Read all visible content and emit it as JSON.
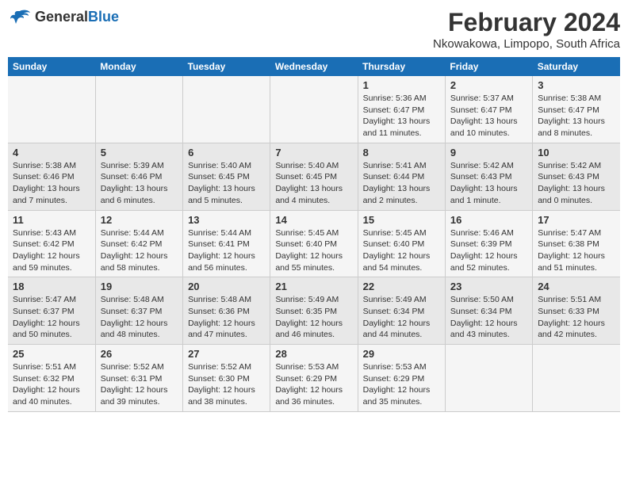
{
  "logo": {
    "text_general": "General",
    "text_blue": "Blue"
  },
  "title": "February 2024",
  "subtitle": "Nkowakowa, Limpopo, South Africa",
  "days_header": [
    "Sunday",
    "Monday",
    "Tuesday",
    "Wednesday",
    "Thursday",
    "Friday",
    "Saturday"
  ],
  "weeks": [
    [
      {
        "day": "",
        "content": ""
      },
      {
        "day": "",
        "content": ""
      },
      {
        "day": "",
        "content": ""
      },
      {
        "day": "",
        "content": ""
      },
      {
        "day": "1",
        "content": "Sunrise: 5:36 AM\nSunset: 6:47 PM\nDaylight: 13 hours\nand 11 minutes."
      },
      {
        "day": "2",
        "content": "Sunrise: 5:37 AM\nSunset: 6:47 PM\nDaylight: 13 hours\nand 10 minutes."
      },
      {
        "day": "3",
        "content": "Sunrise: 5:38 AM\nSunset: 6:47 PM\nDaylight: 13 hours\nand 8 minutes."
      }
    ],
    [
      {
        "day": "4",
        "content": "Sunrise: 5:38 AM\nSunset: 6:46 PM\nDaylight: 13 hours\nand 7 minutes."
      },
      {
        "day": "5",
        "content": "Sunrise: 5:39 AM\nSunset: 6:46 PM\nDaylight: 13 hours\nand 6 minutes."
      },
      {
        "day": "6",
        "content": "Sunrise: 5:40 AM\nSunset: 6:45 PM\nDaylight: 13 hours\nand 5 minutes."
      },
      {
        "day": "7",
        "content": "Sunrise: 5:40 AM\nSunset: 6:45 PM\nDaylight: 13 hours\nand 4 minutes."
      },
      {
        "day": "8",
        "content": "Sunrise: 5:41 AM\nSunset: 6:44 PM\nDaylight: 13 hours\nand 2 minutes."
      },
      {
        "day": "9",
        "content": "Sunrise: 5:42 AM\nSunset: 6:43 PM\nDaylight: 13 hours\nand 1 minute."
      },
      {
        "day": "10",
        "content": "Sunrise: 5:42 AM\nSunset: 6:43 PM\nDaylight: 13 hours\nand 0 minutes."
      }
    ],
    [
      {
        "day": "11",
        "content": "Sunrise: 5:43 AM\nSunset: 6:42 PM\nDaylight: 12 hours\nand 59 minutes."
      },
      {
        "day": "12",
        "content": "Sunrise: 5:44 AM\nSunset: 6:42 PM\nDaylight: 12 hours\nand 58 minutes."
      },
      {
        "day": "13",
        "content": "Sunrise: 5:44 AM\nSunset: 6:41 PM\nDaylight: 12 hours\nand 56 minutes."
      },
      {
        "day": "14",
        "content": "Sunrise: 5:45 AM\nSunset: 6:40 PM\nDaylight: 12 hours\nand 55 minutes."
      },
      {
        "day": "15",
        "content": "Sunrise: 5:45 AM\nSunset: 6:40 PM\nDaylight: 12 hours\nand 54 minutes."
      },
      {
        "day": "16",
        "content": "Sunrise: 5:46 AM\nSunset: 6:39 PM\nDaylight: 12 hours\nand 52 minutes."
      },
      {
        "day": "17",
        "content": "Sunrise: 5:47 AM\nSunset: 6:38 PM\nDaylight: 12 hours\nand 51 minutes."
      }
    ],
    [
      {
        "day": "18",
        "content": "Sunrise: 5:47 AM\nSunset: 6:37 PM\nDaylight: 12 hours\nand 50 minutes."
      },
      {
        "day": "19",
        "content": "Sunrise: 5:48 AM\nSunset: 6:37 PM\nDaylight: 12 hours\nand 48 minutes."
      },
      {
        "day": "20",
        "content": "Sunrise: 5:48 AM\nSunset: 6:36 PM\nDaylight: 12 hours\nand 47 minutes."
      },
      {
        "day": "21",
        "content": "Sunrise: 5:49 AM\nSunset: 6:35 PM\nDaylight: 12 hours\nand 46 minutes."
      },
      {
        "day": "22",
        "content": "Sunrise: 5:49 AM\nSunset: 6:34 PM\nDaylight: 12 hours\nand 44 minutes."
      },
      {
        "day": "23",
        "content": "Sunrise: 5:50 AM\nSunset: 6:34 PM\nDaylight: 12 hours\nand 43 minutes."
      },
      {
        "day": "24",
        "content": "Sunrise: 5:51 AM\nSunset: 6:33 PM\nDaylight: 12 hours\nand 42 minutes."
      }
    ],
    [
      {
        "day": "25",
        "content": "Sunrise: 5:51 AM\nSunset: 6:32 PM\nDaylight: 12 hours\nand 40 minutes."
      },
      {
        "day": "26",
        "content": "Sunrise: 5:52 AM\nSunset: 6:31 PM\nDaylight: 12 hours\nand 39 minutes."
      },
      {
        "day": "27",
        "content": "Sunrise: 5:52 AM\nSunset: 6:30 PM\nDaylight: 12 hours\nand 38 minutes."
      },
      {
        "day": "28",
        "content": "Sunrise: 5:53 AM\nSunset: 6:29 PM\nDaylight: 12 hours\nand 36 minutes."
      },
      {
        "day": "29",
        "content": "Sunrise: 5:53 AM\nSunset: 6:29 PM\nDaylight: 12 hours\nand 35 minutes."
      },
      {
        "day": "",
        "content": ""
      },
      {
        "day": "",
        "content": ""
      }
    ]
  ]
}
